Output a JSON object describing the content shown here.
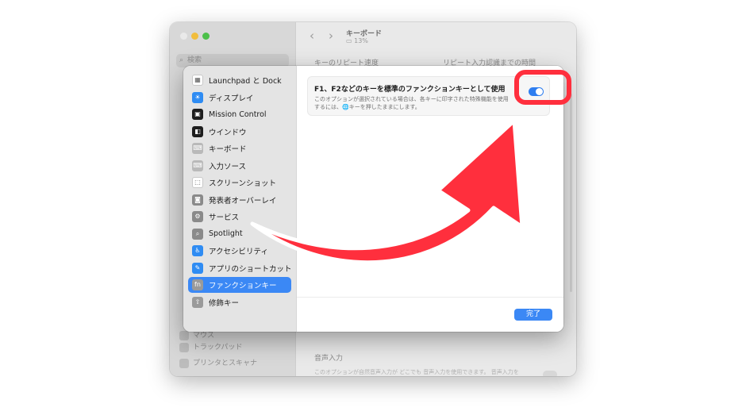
{
  "background_window": {
    "search_placeholder": "検索",
    "title": "キーボード",
    "battery": "13%",
    "label_repeat": "キーのリピート速度",
    "label_delay": "リピート入力認識までの時間",
    "section_voice": "音声入力",
    "sidebar_items": [
      "マウス",
      "トラックパッド",
      "プリンタとスキャナ"
    ],
    "footer_note": "このオプションが自然音声入力が どこでも 音声入力を使用できます。 音声入力を"
  },
  "sheet": {
    "sidebar": {
      "items": [
        {
          "label": "Launchpad と Dock",
          "icon": "launchpad-icon",
          "color": "#ffffff"
        },
        {
          "label": "ディスプレイ",
          "icon": "display-icon",
          "color": "#2f8cf3"
        },
        {
          "label": "Mission Control",
          "icon": "mission-control-icon",
          "color": "#1e1e1e"
        },
        {
          "label": "ウインドウ",
          "icon": "window-icon",
          "color": "#1e1e1e"
        },
        {
          "label": "キーボード",
          "icon": "keyboard-icon",
          "color": "#b9b9b9"
        },
        {
          "label": "入力ソース",
          "icon": "input-source-icon",
          "color": "#b9b9b9"
        },
        {
          "label": "スクリーンショット",
          "icon": "screenshot-icon",
          "color": "#ffffff"
        },
        {
          "label": "発表者オーバーレイ",
          "icon": "presenter-overlay-icon",
          "color": "#8a8a8a"
        },
        {
          "label": "サービス",
          "icon": "gear-icon",
          "color": "#8a8a8a"
        },
        {
          "label": "Spotlight",
          "icon": "spotlight-icon",
          "color": "#8a8a8a"
        },
        {
          "label": "アクセシビリティ",
          "icon": "accessibility-icon",
          "color": "#2f8cf3"
        },
        {
          "label": "アプリのショートカット",
          "icon": "app-shortcuts-icon",
          "color": "#2f8cf3"
        },
        {
          "label": "ファンクションキー",
          "icon": "function-key-icon",
          "color": "#9a9a9a",
          "selected": true
        },
        {
          "label": "修飾キー",
          "icon": "modifier-key-icon",
          "color": "#9a9a9a"
        }
      ]
    },
    "option": {
      "title": "F1、F2などのキーを標準のファンクションキーとして使用",
      "description": "このオプションが選択されている場合は、各キーに印字された特殊機能を使用するには、🌐キーを押したままにします。",
      "toggle_on": true
    },
    "done_label": "完了"
  },
  "colors": {
    "accent": "#3b88f5",
    "annotation_red": "#ff2f3d"
  }
}
